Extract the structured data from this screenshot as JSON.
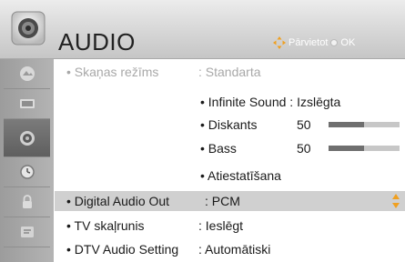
{
  "header": {
    "title": "AUDIO",
    "hint_move": "Pārvietot",
    "hint_ok": "OK"
  },
  "sidebar": {
    "items": [
      {
        "name": "picture",
        "icon": "picture-icon",
        "active": false
      },
      {
        "name": "screen",
        "icon": "screen-icon",
        "active": false
      },
      {
        "name": "audio",
        "icon": "speaker-icon",
        "active": true
      },
      {
        "name": "time",
        "icon": "clock-icon",
        "active": false
      },
      {
        "name": "lock",
        "icon": "lock-icon",
        "active": false
      },
      {
        "name": "option",
        "icon": "option-icon",
        "active": false
      }
    ]
  },
  "menu": {
    "sound_mode": {
      "label": "• Skaņas režīms",
      "value": ": Standarta"
    },
    "infinite_sound": {
      "label": "• Infinite Sound : Izslēgta"
    },
    "treble": {
      "label": "• Diskants",
      "value": "50",
      "level_percent": 50
    },
    "bass": {
      "label": "• Bass",
      "value": "50",
      "level_percent": 50
    },
    "reset": {
      "label": "• Atiestatīšana"
    },
    "digital_audio_out": {
      "label": "• Digital Audio Out",
      "value": ": PCM"
    },
    "tv_speaker": {
      "label": "• TV skaļrunis",
      "value": ": Ieslēgt"
    },
    "dtv_audio": {
      "label": "• DTV Audio Setting",
      "value": ": Automātiski"
    }
  },
  "colors": {
    "highlight": "#d0d0d0",
    "accent_orange": "#f0a020",
    "bar_fill": "#6f6f6f",
    "dim_text": "#a8a8a8"
  }
}
